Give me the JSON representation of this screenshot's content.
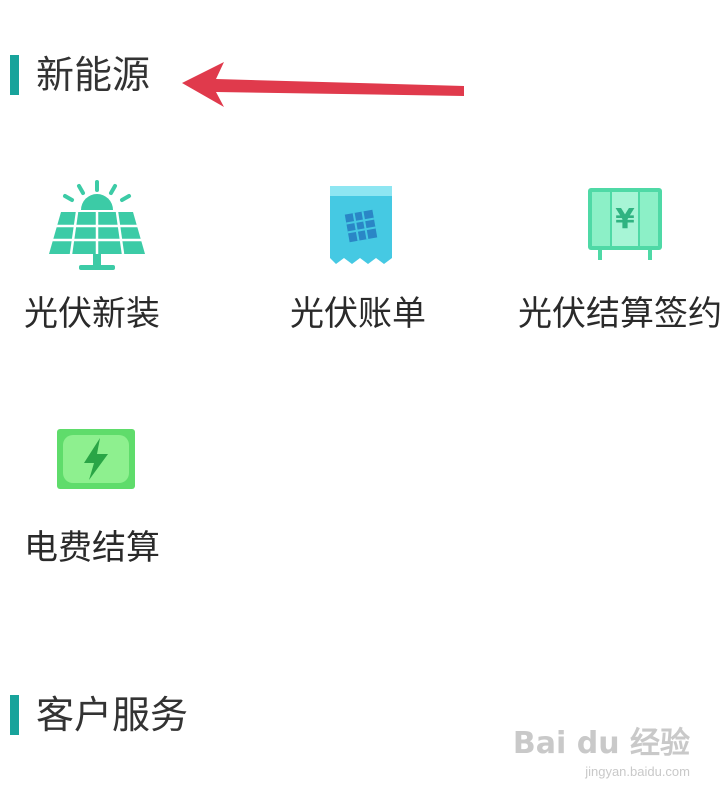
{
  "sections": [
    {
      "title": "新能源"
    },
    {
      "title": "客户服务"
    }
  ],
  "tiles": [
    {
      "label": "光伏新装",
      "icon": "solar-panel-icon"
    },
    {
      "label": "光伏账单",
      "icon": "bill-receipt-icon"
    },
    {
      "label": "光伏结算签约",
      "icon": "yuan-cabinet-icon"
    },
    {
      "label": "电费结算",
      "icon": "lightning-card-icon"
    }
  ],
  "annotation": {
    "icon": "red-arrow-icon",
    "color": "#e03a4c"
  },
  "watermark": {
    "logo": "Bai du 经验",
    "url": "jingyan.baidu.com"
  },
  "colors": {
    "accent": "#18a39b",
    "text": "#2a2a2a",
    "icon_teal": "#3ccba6",
    "icon_green": "#5fdc6b"
  }
}
